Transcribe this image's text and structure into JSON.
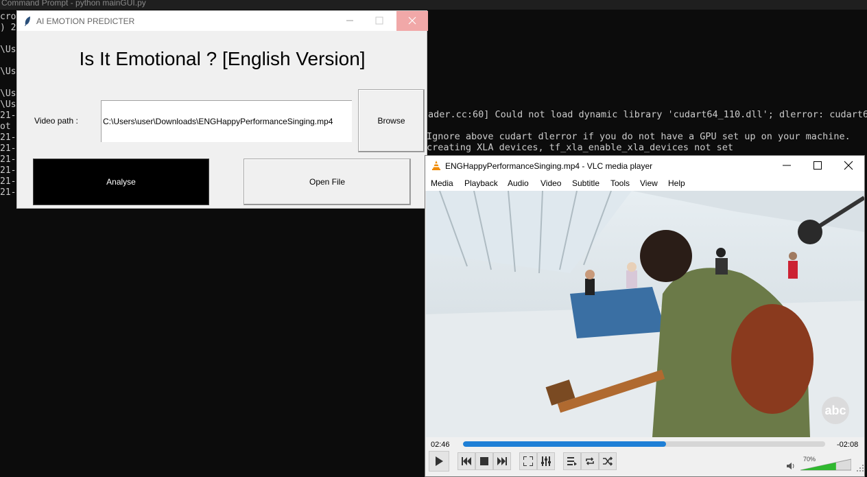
{
  "cmd": {
    "title": "Command Prompt - python  mainGUI.py",
    "left_fragments": [
      "cro",
      ") 2",
      "\\Us",
      "\\Us",
      "\\Us",
      "\\Us",
      "21-",
      "ot",
      "21-",
      "21-",
      "21-",
      "21-",
      "21-",
      "21-"
    ],
    "right_lines": [
      "ader.cc:60] Could not load dynamic library 'cudart64_110.dll'; dlerror: cudart64_",
      " Ignore above cudart dlerror if you do not have a GPU set up on your machine.",
      "creating XLA devices, tf_xla_enable_xla_devices not set"
    ]
  },
  "emotion_app": {
    "title": "AI EMOTION PREDICTER",
    "heading": "Is It Emotional ? [English Version]",
    "video_path_label": "Video path :",
    "video_path_value": "C:\\Users\\user\\Downloads\\ENGHappyPerformanceSinging.mp4",
    "browse_label": "Browse",
    "analyse_label": "Analyse",
    "open_file_label": "Open File"
  },
  "vlc": {
    "title": "ENGHappyPerformanceSinging.mp4 - VLC media player",
    "menu": [
      "Media",
      "Playback",
      "Audio",
      "Video",
      "Subtitle",
      "Tools",
      "View",
      "Help"
    ],
    "elapsed": "02:46",
    "remaining": "-02:08",
    "progress": 0.56,
    "volume_label": "70%",
    "volume": 0.7,
    "watermark": "abc",
    "accent": "#1e7fd6",
    "volume_color": "#2fb82f",
    "icons": [
      "play-icon",
      "previous-icon",
      "stop-icon",
      "next-icon",
      "fullscreen-icon",
      "extended-settings-icon",
      "playlist-icon",
      "loop-icon",
      "shuffle-icon",
      "speaker-icon"
    ]
  }
}
